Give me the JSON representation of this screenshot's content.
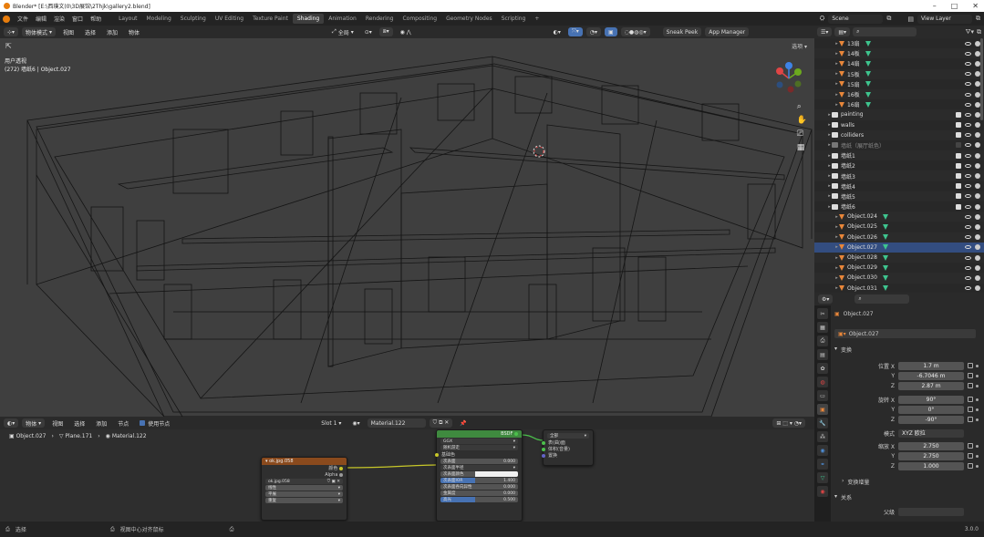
{
  "titlebar": {
    "title": "Blender* [E:\\西璞文(0\\3D展馆\\2Thjk\\gallery2.blend]",
    "min": "–",
    "max": "□",
    "close": "✕"
  },
  "menubar": {
    "menus": [
      "文件",
      "编辑",
      "渲染",
      "窗口",
      "帮助"
    ],
    "workspaces": [
      "Layout",
      "Modeling",
      "Sculpting",
      "UV Editing",
      "Texture Paint",
      "Shading",
      "Animation",
      "Rendering",
      "Compositing",
      "Geometry Nodes",
      "Scripting"
    ],
    "add_tab": "+",
    "scene": "Scene",
    "view_layer": "View Layer"
  },
  "viewport": {
    "mode": "物体模式",
    "menus": [
      "视图",
      "选择",
      "添加",
      "物体"
    ],
    "transform": "全局",
    "sneak_peek": "Sneak Peek",
    "app_manager": "App Manager",
    "options": "选项",
    "view_name": "用户透视",
    "object_info": "(272) 墙纸6 | Object.027"
  },
  "node_editor": {
    "mode": "物体",
    "menus": [
      "视图",
      "选择",
      "添加",
      "节点"
    ],
    "use_nodes": "使用节点",
    "slot": "Slot 1",
    "material": "Material.122",
    "breadcrumb": [
      "Object.027",
      "Plane.171",
      "Material.122"
    ],
    "image_node": {
      "title": "ok.jpg.058",
      "out_color": "颜色",
      "out_alpha": "Alpha",
      "image": "ok.jpg.058",
      "interp": "线性",
      "proj": "平展",
      "ext": "重复"
    },
    "bsdf_node": {
      "title": "BSDF",
      "dist": "GGX",
      "subsurf": "随机游走",
      "base_color": "基础色",
      "rows": [
        {
          "label": "次表面",
          "value": "0.000"
        },
        {
          "label": "次表面半径",
          "value": ""
        },
        {
          "label": "次表面颜色",
          "value": ""
        },
        {
          "label": "次表面IOR",
          "value": "1.400"
        },
        {
          "label": "次表面各向异性",
          "value": "0.000"
        },
        {
          "label": "金属度",
          "value": "0.000"
        },
        {
          "label": "高光",
          "value": "0.500"
        }
      ]
    },
    "output_node": {
      "title": "全部",
      "rows": [
        "表(曲)面",
        "体积(音量)",
        "置换"
      ]
    }
  },
  "statusbar": {
    "select": "选择",
    "center": "视图中心对齐鼠标",
    "version": "3.0.0"
  },
  "outliner": {
    "rows": [
      {
        "name": "13扇",
        "type": "mesh",
        "indent": 2,
        "mod": true
      },
      {
        "name": "14板",
        "type": "mesh",
        "indent": 2,
        "mod": true
      },
      {
        "name": "14扇",
        "type": "mesh",
        "indent": 2,
        "mod": true
      },
      {
        "name": "15板",
        "type": "mesh",
        "indent": 2,
        "mod": true
      },
      {
        "name": "15扇",
        "type": "mesh",
        "indent": 2,
        "mod": true
      },
      {
        "name": "16板",
        "type": "mesh",
        "indent": 2,
        "mod": true
      },
      {
        "name": "16扇",
        "type": "mesh",
        "indent": 2,
        "mod": true
      },
      {
        "name": "painting",
        "type": "coll",
        "indent": 1,
        "mod": false
      },
      {
        "name": "walls",
        "type": "coll",
        "indent": 1,
        "mod": false
      },
      {
        "name": "colliders",
        "type": "coll",
        "indent": 1,
        "mod": false
      },
      {
        "name": "墙纸（展厅纸色）",
        "type": "coll",
        "indent": 1,
        "mod": false,
        "off": true
      },
      {
        "name": "墙纸1",
        "type": "coll",
        "indent": 1,
        "mod": false
      },
      {
        "name": "墙纸2",
        "type": "coll",
        "indent": 1,
        "mod": false
      },
      {
        "name": "墙纸3",
        "type": "coll",
        "indent": 1,
        "mod": false
      },
      {
        "name": "墙纸4",
        "type": "coll",
        "indent": 1,
        "mod": false
      },
      {
        "name": "墙纸5",
        "type": "coll",
        "indent": 1,
        "mod": false
      },
      {
        "name": "墙纸6",
        "type": "coll",
        "indent": 1,
        "mod": false
      },
      {
        "name": "Object.024",
        "type": "mesh",
        "indent": 2,
        "mod": true
      },
      {
        "name": "Object.025",
        "type": "mesh",
        "indent": 2,
        "mod": true
      },
      {
        "name": "Object.026",
        "type": "mesh",
        "indent": 2,
        "mod": true
      },
      {
        "name": "Object.027",
        "type": "mesh",
        "indent": 2,
        "mod": true
      },
      {
        "name": "Object.028",
        "type": "mesh",
        "indent": 2,
        "mod": true
      },
      {
        "name": "Object.029",
        "type": "mesh",
        "indent": 2,
        "mod": true
      },
      {
        "name": "Object.030",
        "type": "mesh",
        "indent": 2,
        "mod": true
      },
      {
        "name": "Object.031",
        "type": "mesh",
        "indent": 2,
        "mod": true
      }
    ]
  },
  "properties": {
    "object_name": "Object.027",
    "object_field": "Object.027",
    "transform_label": "变换",
    "location_x_label": "位置 X",
    "location_x": "1.7 m",
    "location_y": "-6.7046 m",
    "location_z": "2.87 m",
    "rotation_x_label": "旋转 X",
    "rotation_x": "90°",
    "rotation_y": "0°",
    "rotation_z": "-90°",
    "mode_label": "模式",
    "mode_value": "XYZ 欧拉",
    "scale_x_label": "缩放 X",
    "scale_x": "2.750",
    "scale_y": "2.750",
    "scale_z": "1.000",
    "delta_label": "变换增量",
    "relations_label": "关系",
    "parent_label": "父级",
    "y_label": "Y",
    "z_label": "Z"
  }
}
